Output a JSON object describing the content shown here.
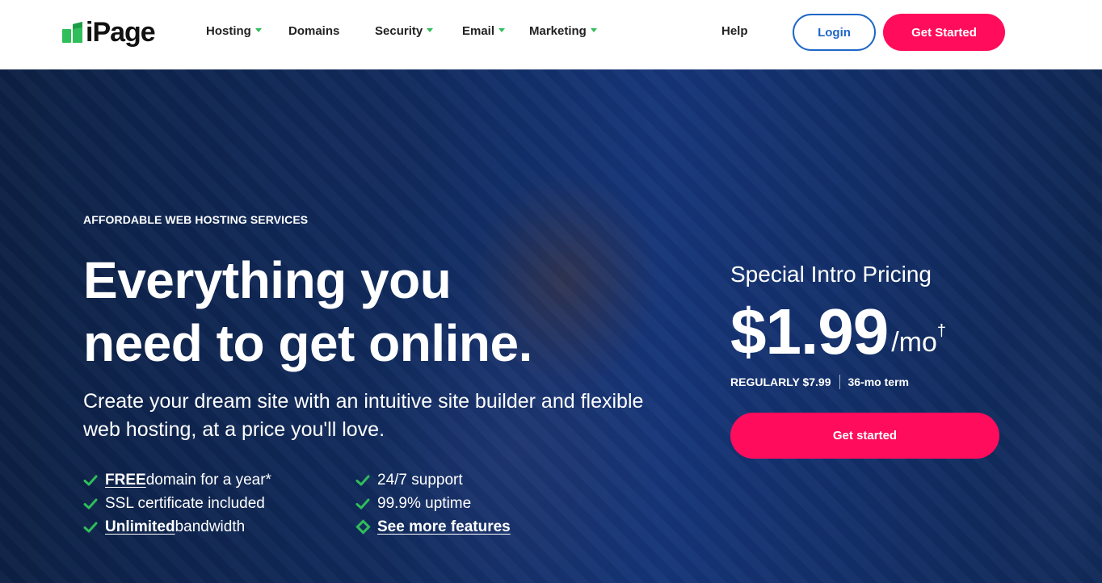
{
  "brand": {
    "name": "iPage",
    "accent": "#2fbe5a",
    "cta_color": "#ff0c5c",
    "link_color": "#1f67c8"
  },
  "nav": {
    "items": [
      {
        "label": "Hosting",
        "has_dropdown": true
      },
      {
        "label": "Domains",
        "has_dropdown": false
      },
      {
        "label": "Security",
        "has_dropdown": true
      },
      {
        "label": "Email",
        "has_dropdown": true
      },
      {
        "label": "Marketing",
        "has_dropdown": true
      }
    ],
    "help": "Help",
    "login": "Login",
    "get_started": "Get Started"
  },
  "hero": {
    "eyebrow": "AFFORDABLE WEB HOSTING SERVICES",
    "headline_line1": "Everything you",
    "headline_line2": "need to get online.",
    "subhead": "Create your dream site with an intuitive site builder and flexible web hosting, at a price you'll love.",
    "features_left": [
      {
        "strong": "FREE",
        "text": " domain for a year*"
      },
      {
        "strong": "",
        "text": "SSL certificate included"
      },
      {
        "strong": "Unlimited",
        "text": " bandwidth"
      }
    ],
    "features_right": [
      {
        "text": "24/7 support"
      },
      {
        "text": "99.9% uptime"
      }
    ],
    "see_more": "See more features"
  },
  "pricing": {
    "label": "Special Intro Pricing",
    "amount": "$1.99",
    "unit": "/mo",
    "dagger": "†",
    "regular": "REGULARLY $7.99",
    "term": "36-mo term",
    "cta": "Get started"
  }
}
